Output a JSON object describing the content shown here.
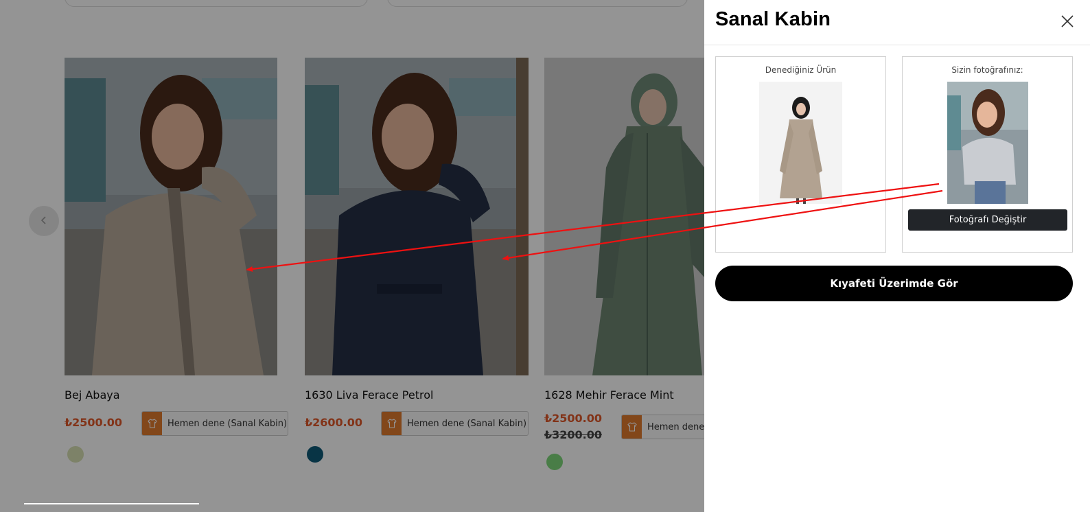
{
  "products": [
    {
      "name": "Bej Abaya",
      "price": "₺2500.00",
      "old_price": "",
      "try_label": "Hemen dene (Sanal Kabin)",
      "swatch_color": "#d7e0b3"
    },
    {
      "name": "1630 Liva Ferace Petrol",
      "price": "₺2600.00",
      "old_price": "",
      "try_label": "Hemen dene (Sanal Kabin)",
      "swatch_color": "#0e5a78"
    },
    {
      "name": "1628 Mehir Ferace Mint",
      "price": "₺2500.00",
      "old_price": "₺3200.00",
      "try_label": "Hemen dene",
      "swatch_color": "#7ed87a"
    }
  ],
  "carousel": {
    "prev_icon": "chevron-left-icon"
  },
  "drawer": {
    "title": "Sanal Kabin",
    "close_icon": "close-icon",
    "product_panel_title": "Denediğiniz Ürün",
    "photo_panel_title": "Sizin fotoğrafınız:",
    "change_photo_label": "Fotoğrafı Değiştir",
    "see_on_me_label": "Kıyafeti Üzerimde Gör"
  },
  "colors": {
    "price": "#e0592a",
    "try_icon_bg": "#e07a2e",
    "annotation_arrow": "#ee1111",
    "primary_button": "#000000"
  }
}
